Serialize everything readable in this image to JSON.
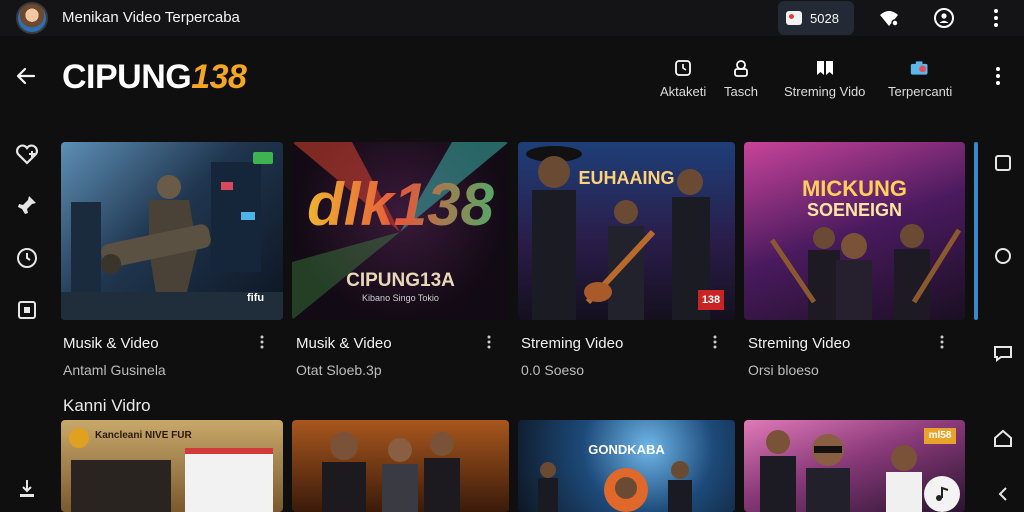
{
  "statusbar": {
    "app_title": "Menikan Video Terpercaba",
    "notif_count": "5028"
  },
  "header": {
    "logo_white": "CIPUNG",
    "logo_orange": "138",
    "nav": [
      {
        "label": "Aktaketi"
      },
      {
        "label": "Tasch"
      },
      {
        "label": "Streming Vido"
      },
      {
        "label": "Terpercanti"
      }
    ]
  },
  "cards_row1": [
    {
      "title": "Musik & Video",
      "sub": "Antaml Gusinela",
      "badge": "fifu"
    },
    {
      "title": "Musik & Video",
      "sub": "Otat Sloeb.3p",
      "poster_big": "dlk138",
      "poster_name": "CIPUNG13A",
      "poster_small": "Kibano Singo Tokio"
    },
    {
      "title": "Streming Video",
      "sub": "0.0 Soeso",
      "poster_title": "EUHAAING",
      "badge": "138"
    },
    {
      "title": "Streming Video",
      "sub": "Orsi bloeso",
      "poster_title_1": "MICKUNG",
      "poster_title_2": "SOENEIGN"
    }
  ],
  "section": {
    "title": "Kanni Vidro"
  },
  "cards_row2": [
    {
      "poster_text": "Kancleani NIVE FUR"
    },
    {},
    {
      "poster_title": "GONDKABA"
    },
    {
      "badge": "ml58"
    }
  ],
  "colors": {
    "accent_orange": "#f5a623",
    "scroll_blue": "#3b87c9",
    "bg": "#0f0f10"
  },
  "icons": {
    "back": "arrow-left-icon",
    "rail": [
      "heart-plus-icon",
      "pin-icon",
      "history-icon",
      "library-icon",
      "download-icon"
    ],
    "right_nav": [
      "square-icon",
      "circle-icon",
      "chat-icon",
      "home-icon",
      "chevron-left-icon"
    ]
  }
}
